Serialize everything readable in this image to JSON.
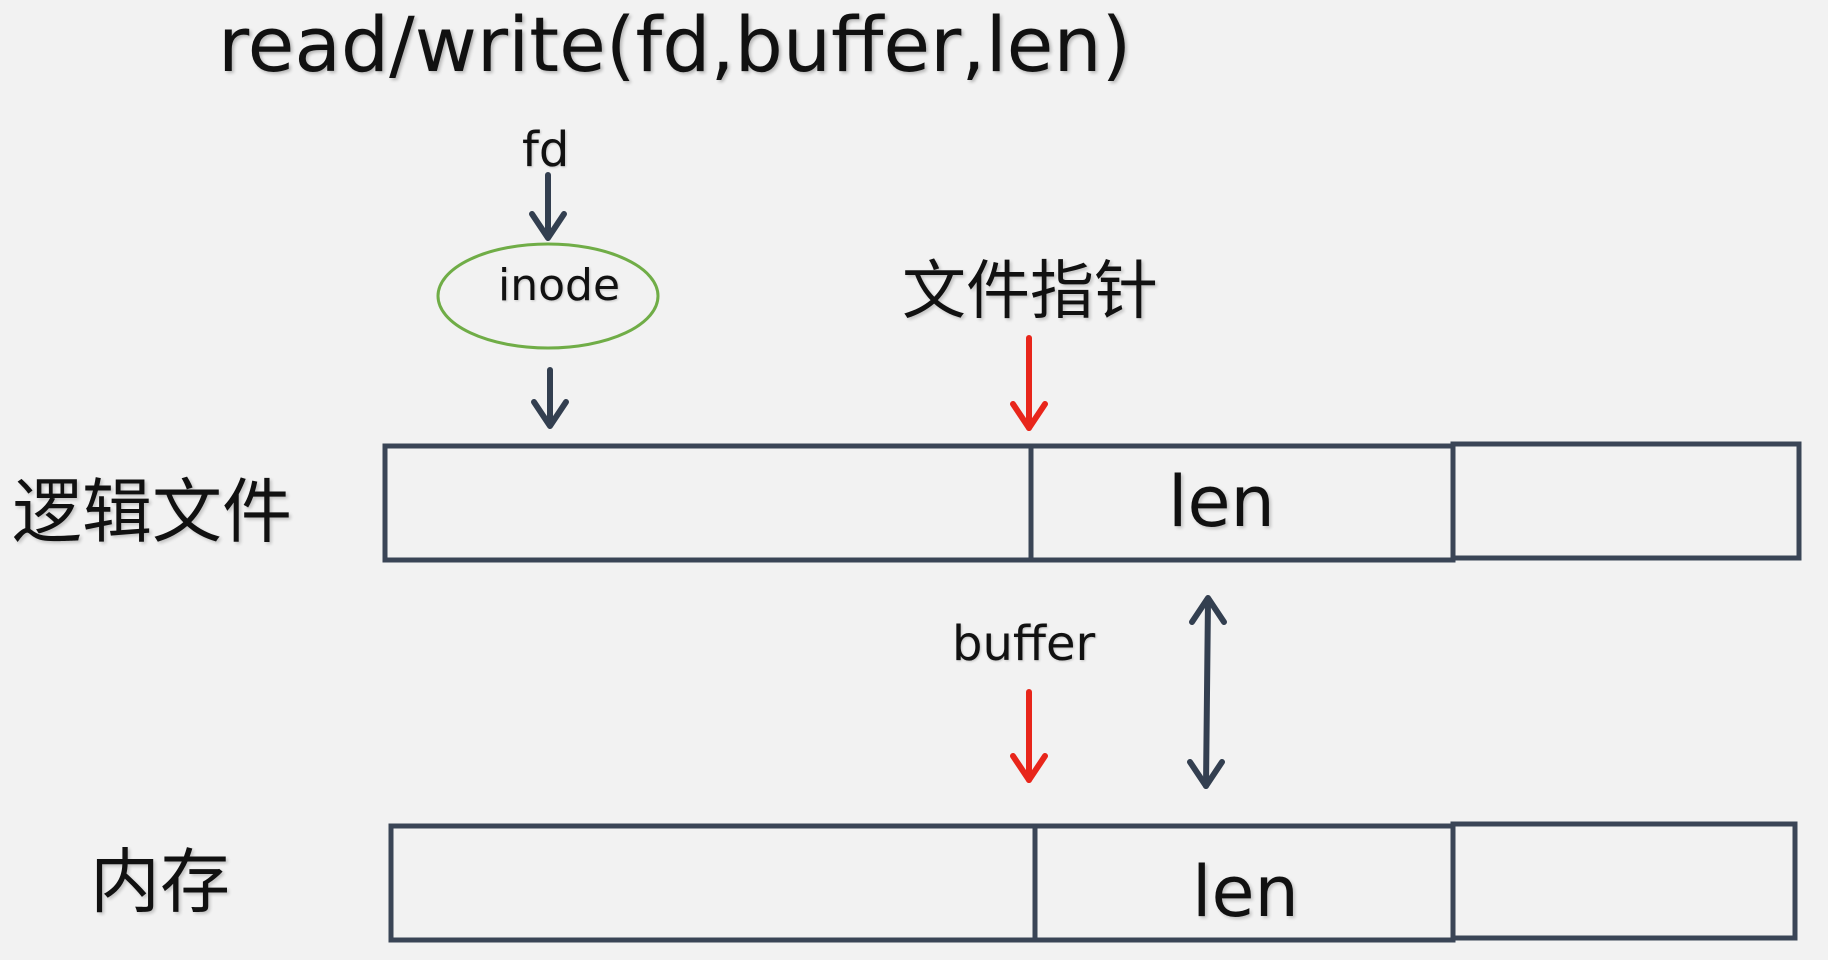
{
  "title": "read/write(fd,buffer,len)",
  "labels": {
    "fd": "fd",
    "inode": "inode",
    "file_pointer": "文件指针",
    "logical_file": "逻辑文件",
    "buffer": "buffer",
    "memory": "内存",
    "len_file": "len",
    "len_memory": "len"
  },
  "colors": {
    "background": "#f2f2f2",
    "box_stroke": "#3a4556",
    "arrow_dark": "#333f50",
    "arrow_red": "#e8261b",
    "inode_stroke": "#70ad47"
  }
}
